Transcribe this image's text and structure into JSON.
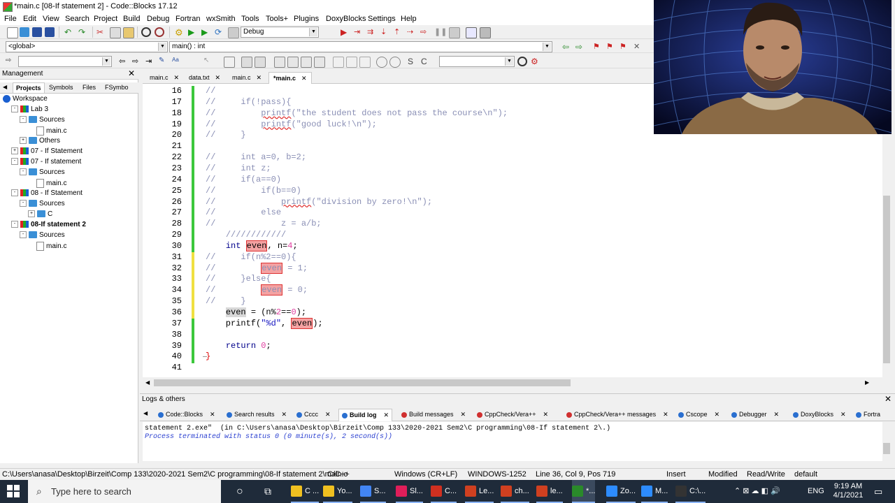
{
  "window": {
    "title": "*main.c [08-If statement 2] - Code::Blocks 17.12"
  },
  "menu": [
    "File",
    "Edit",
    "View",
    "Search",
    "Project",
    "Build",
    "Debug",
    "Fortran",
    "wxSmith",
    "Tools",
    "Tools+",
    "Plugins",
    "DoxyBlocks",
    "Settings",
    "Help"
  ],
  "toolbar": {
    "build_target": "Debug",
    "scope": "<global>",
    "function": "main() : int"
  },
  "management": {
    "title": "Management",
    "tabs": [
      "Projects",
      "Symbols",
      "Files",
      "FSymbo"
    ],
    "tree": [
      {
        "label": "Workspace",
        "level": 0,
        "icon": "workspace",
        "toggle": ""
      },
      {
        "label": "Lab 3",
        "level": 1,
        "icon": "project",
        "toggle": "-"
      },
      {
        "label": "Sources",
        "level": 2,
        "icon": "folder",
        "toggle": "-"
      },
      {
        "label": "main.c",
        "level": 3,
        "icon": "file",
        "toggle": ""
      },
      {
        "label": "Others",
        "level": 2,
        "icon": "folder",
        "toggle": "+"
      },
      {
        "label": "07 - If Statement",
        "level": 1,
        "icon": "project",
        "toggle": "+"
      },
      {
        "label": "07 - If statement",
        "level": 1,
        "icon": "project",
        "toggle": "-"
      },
      {
        "label": "Sources",
        "level": 2,
        "icon": "folder",
        "toggle": "-"
      },
      {
        "label": "main.c",
        "level": 3,
        "icon": "file",
        "toggle": ""
      },
      {
        "label": "08 - If Statement",
        "level": 1,
        "icon": "project",
        "toggle": "-"
      },
      {
        "label": "Sources",
        "level": 2,
        "icon": "folder",
        "toggle": "-"
      },
      {
        "label": "C",
        "level": 3,
        "icon": "folder",
        "toggle": "+"
      },
      {
        "label": "08-If statement 2",
        "level": 1,
        "icon": "project",
        "toggle": "-",
        "bold": true
      },
      {
        "label": "Sources",
        "level": 2,
        "icon": "folder",
        "toggle": "-"
      },
      {
        "label": "main.c",
        "level": 3,
        "icon": "file",
        "toggle": ""
      }
    ]
  },
  "editor_tabs": [
    {
      "label": "main.c",
      "active": false
    },
    {
      "label": "data.txt",
      "active": false
    },
    {
      "label": "main.c",
      "active": false
    },
    {
      "label": "*main.c",
      "active": true
    }
  ],
  "code_lines": [
    {
      "n": "16",
      "html": "<span class='cmt'>//</span>",
      "chg": "green"
    },
    {
      "n": "17",
      "html": "<span class='cmt'>//     if(!pass){</span>",
      "chg": "green"
    },
    {
      "n": "18",
      "html": "<span class='cmt'>//         <span class='sq'>printf</span>(\"the student does not pass the course\\n\");</span>",
      "chg": "green"
    },
    {
      "n": "19",
      "html": "<span class='cmt'>//         <span class='sq'>printf</span>(\"good luck!\\n\");</span>",
      "chg": "green"
    },
    {
      "n": "20",
      "html": "<span class='cmt'>//     }</span>",
      "chg": "green"
    },
    {
      "n": "21",
      "html": "",
      "chg": "green"
    },
    {
      "n": "22",
      "html": "<span class='cmt'>//     int a=0, b=2;</span>",
      "chg": "green"
    },
    {
      "n": "23",
      "html": "<span class='cmt'>//     int z;</span>",
      "chg": "green"
    },
    {
      "n": "24",
      "html": "<span class='cmt'>//     if(a==0)</span>",
      "chg": "green"
    },
    {
      "n": "25",
      "html": "<span class='cmt'>//         if(b==0)</span>",
      "chg": "green"
    },
    {
      "n": "26",
      "html": "<span class='cmt'>//             <span class='sq'>printf</span>(\"division by zero!\\n\");</span>",
      "chg": "green"
    },
    {
      "n": "27",
      "html": "<span class='cmt'>//         else</span>",
      "chg": "green"
    },
    {
      "n": "28",
      "html": "<span class='cmt'>//             z = a/b;</span>",
      "chg": "green"
    },
    {
      "n": "29",
      "html": "    <span class='cmt'>////////////</span>",
      "chg": "green"
    },
    {
      "n": "30",
      "html": "    <span class='kw'>int</span> <span class='hl'>even</span>, n=<span class='num'>4</span>;",
      "chg": "green"
    },
    {
      "n": "31",
      "html": "<span class='cmt'>//     if(n%2==0){</span>",
      "chg": "yellow"
    },
    {
      "n": "32",
      "html": "<span class='cmt'>//         <span class='hl'>even</span> = 1;</span>",
      "chg": "yellow"
    },
    {
      "n": "33",
      "html": "<span class='cmt'>//     }else{</span>",
      "chg": "yellow"
    },
    {
      "n": "34",
      "html": "<span class='cmt'>//         <span class='hl'>even</span> = 0;</span>",
      "chg": "yellow"
    },
    {
      "n": "35",
      "html": "<span class='cmt'>//     }</span>",
      "chg": "yellow"
    },
    {
      "n": "36",
      "html": "    <span class='hlg'>even</span> = (n%<span class='num'>2</span>==<span class='num'>0</span>);",
      "chg": "yellow"
    },
    {
      "n": "37",
      "html": "    printf(<span class='str'>\"%d\"</span>, <span class='hl'>even</span>);",
      "chg": "green"
    },
    {
      "n": "38",
      "html": "",
      "chg": "green"
    },
    {
      "n": "39",
      "html": "    <span class='kw'>return</span> <span class='num'>0</span>;",
      "chg": "green"
    },
    {
      "n": "40",
      "html": "<span style='color:#d00'>}</span>",
      "chg": "green"
    },
    {
      "n": "41",
      "html": "",
      "chg": ""
    }
  ],
  "logs": {
    "title": "Logs & others",
    "tabs": [
      "Code::Blocks",
      "Search results",
      "Cccc",
      "Build log",
      "Build messages",
      "CppCheck/Vera++",
      "CppCheck/Vera++ messages",
      "Cscope",
      "Debugger",
      "DoxyBlocks",
      "Fortra"
    ],
    "active_tab": "Build log",
    "line1": "statement 2.exe\"  (in C:\\Users\\anasa\\Desktop\\Birzeit\\Comp 133\\2020-2021 Sem2\\C programming\\08-If statement 2\\.)",
    "line2": "Process terminated with status 0 (0 minute(s), 2 second(s))"
  },
  "status": {
    "path": "C:\\Users\\anasa\\Desktop\\Birzeit\\Comp 133\\2020-2021 Sem2\\C programming\\08-If statement 2\\main.c",
    "lang": "C/C++",
    "eol": "Windows (CR+LF)",
    "encoding": "WINDOWS-1252",
    "position": "Line 36, Col 9, Pos 719",
    "mode": "Insert",
    "modified": "Modified",
    "access": "Read/Write",
    "profile": "default"
  },
  "taskbar": {
    "search_placeholder": "Type here to search",
    "apps": [
      "C ...",
      "Yo...",
      "S...",
      "Sl...",
      "C...",
      "Le...",
      "ch...",
      "le...",
      "*...",
      "Zo...",
      "M...",
      "C:\\..."
    ],
    "lang": "ENG",
    "time": "9:19 AM",
    "date": "4/1/2021"
  }
}
